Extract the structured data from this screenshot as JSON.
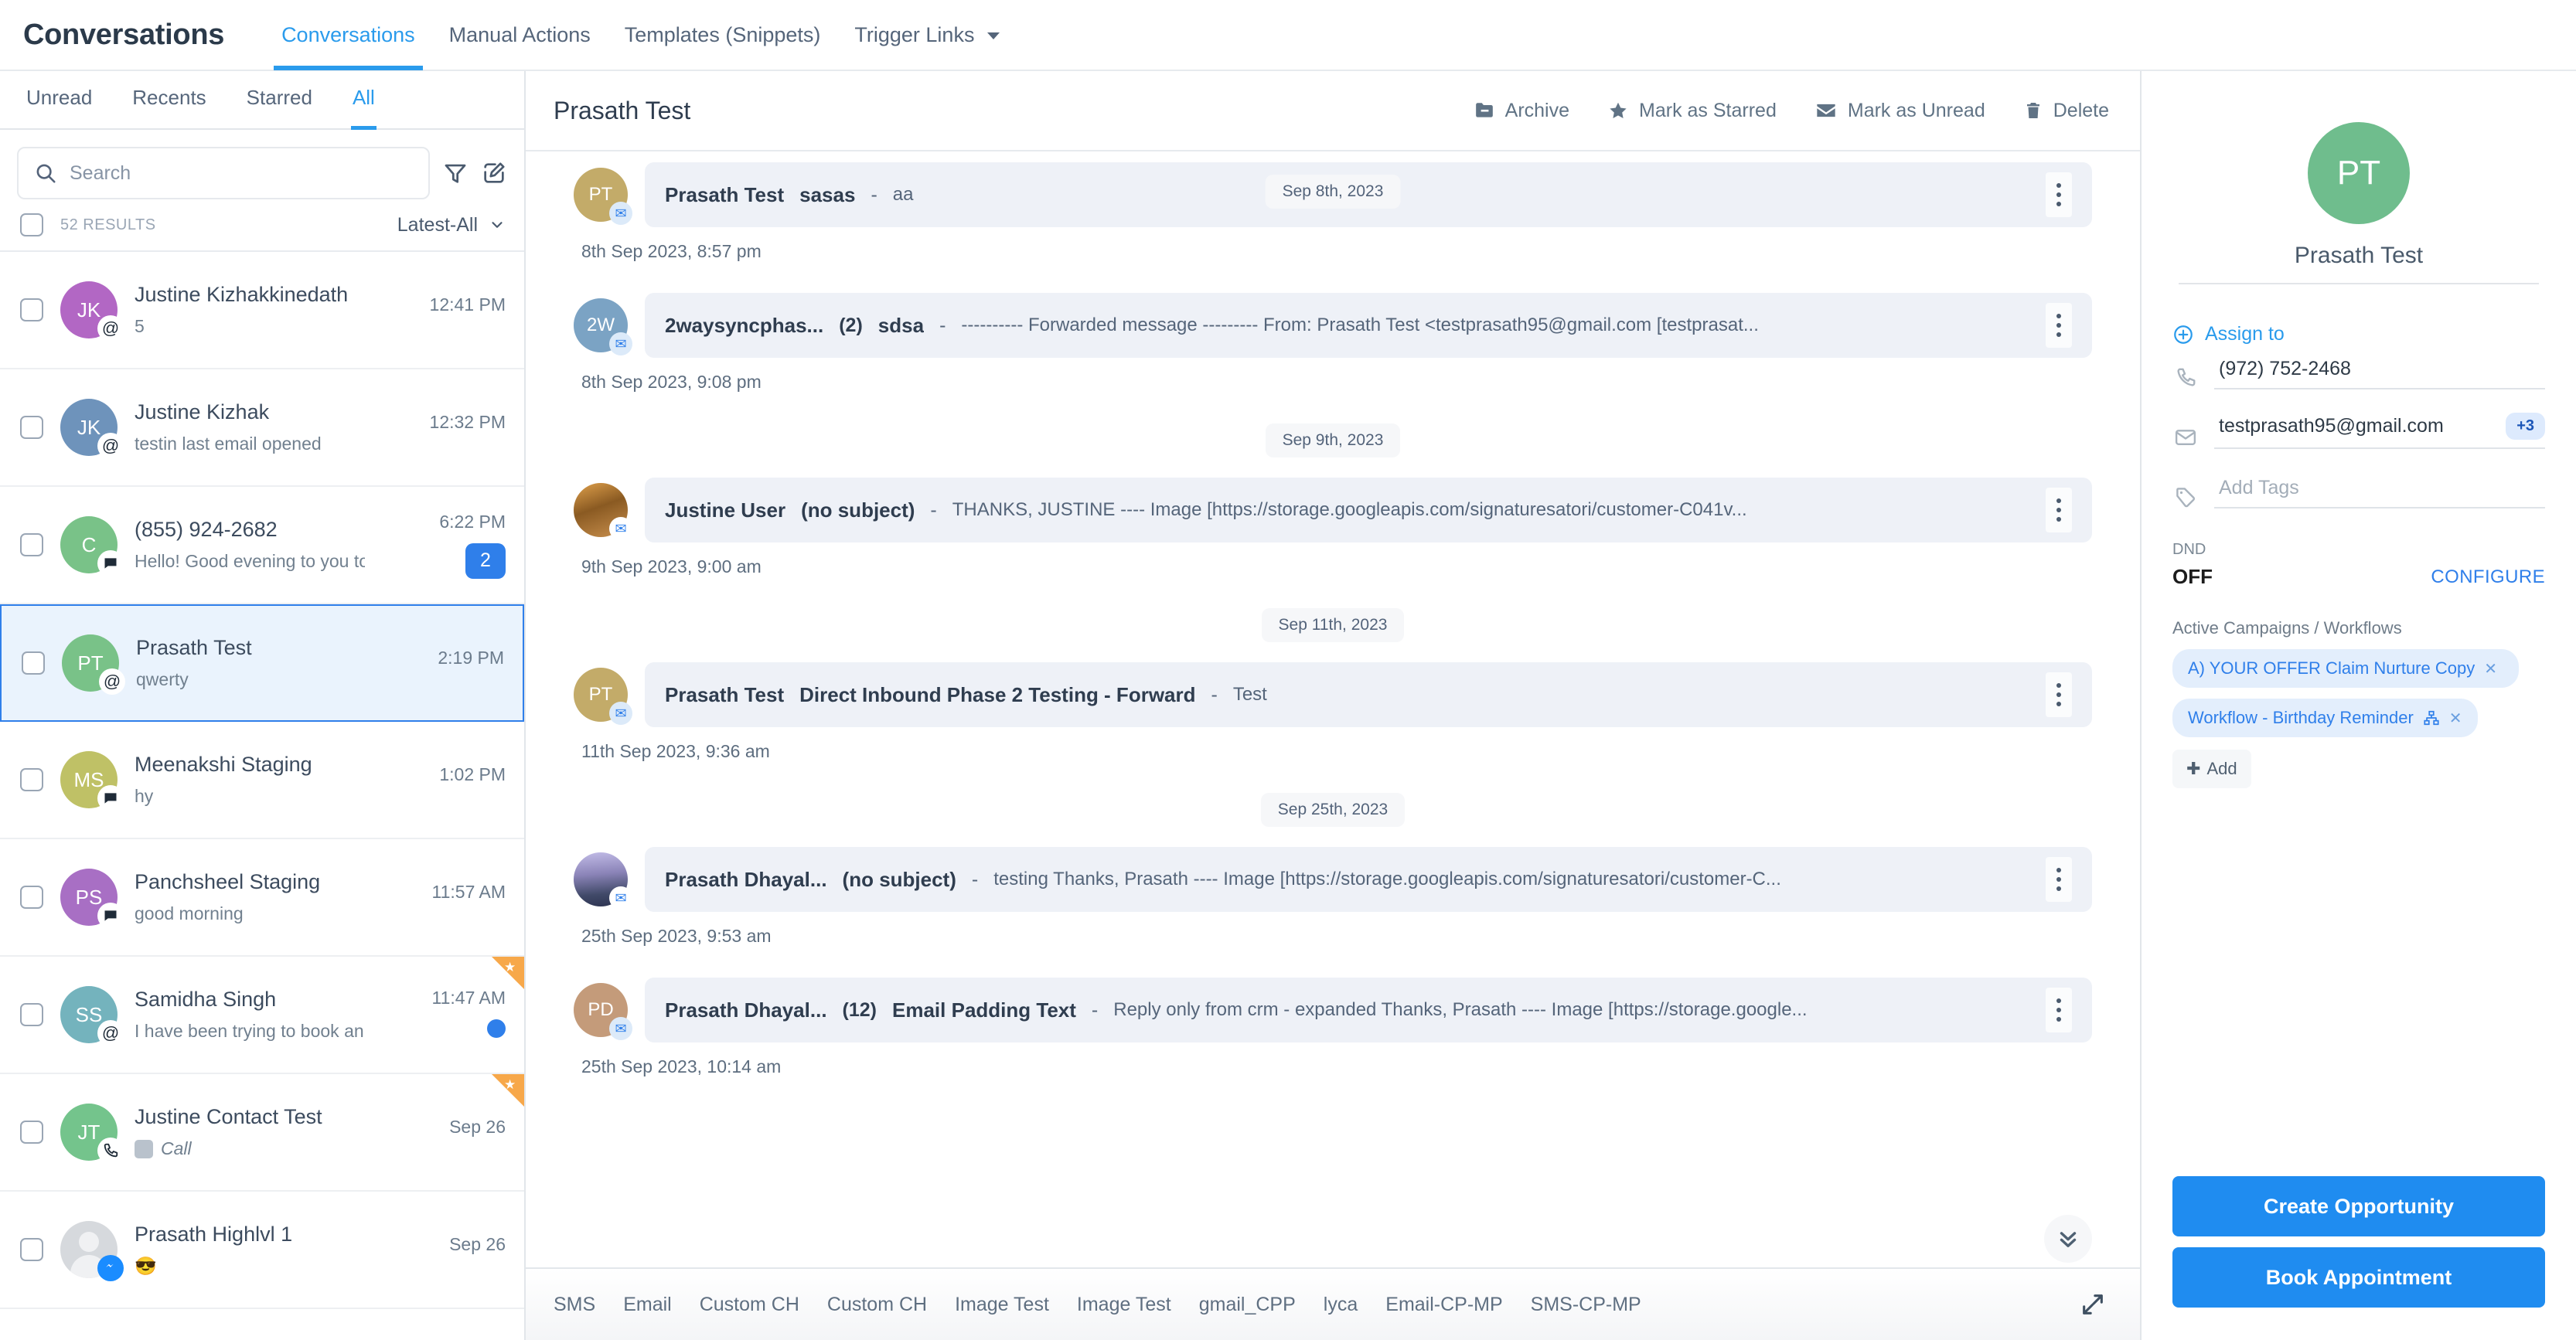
{
  "header": {
    "app_title": "Conversations",
    "nav": [
      {
        "label": "Conversations",
        "active": true
      },
      {
        "label": "Manual Actions",
        "active": false
      },
      {
        "label": "Templates (Snippets)",
        "active": false
      },
      {
        "label": "Trigger Links",
        "active": false,
        "caret": true
      }
    ]
  },
  "left": {
    "filter_tabs": [
      {
        "label": "Unread"
      },
      {
        "label": "Recents"
      },
      {
        "label": "Starred"
      },
      {
        "label": "All"
      }
    ],
    "search": {
      "placeholder": "Search",
      "value": ""
    },
    "results_count": "52 RESULTS",
    "sort_label": "Latest-All",
    "conversations": [
      {
        "initials": "JK",
        "color": "#b islands",
        "avatar_color": "#b267c4",
        "name": "Justine Kizhakkinedath",
        "preview": "5",
        "time": "12:41 PM",
        "channel": "@",
        "badge": "",
        "starred": false,
        "selected": false
      },
      {
        "initials": "JK",
        "avatar_color": "#6e93bb",
        "name": "Justine Kizhak",
        "preview": "testin last email opened",
        "time": "12:32 PM",
        "channel": "@",
        "badge": "",
        "starred": false,
        "selected": false
      },
      {
        "initials": "C",
        "avatar_color": "#79c288",
        "name": "(855) 924-2682",
        "preview": "Hello! Good evening to you too! How",
        "time": "6:22 PM",
        "channel": "sms",
        "badge": "2",
        "starred": false,
        "selected": false
      },
      {
        "initials": "PT",
        "avatar_color": "#79c288",
        "name": "Prasath Test",
        "preview": "qwerty",
        "time": "2:19 PM",
        "channel": "@",
        "badge": "",
        "starred": false,
        "selected": true
      },
      {
        "initials": "MS",
        "avatar_color": "#bfc166",
        "name": "Meenakshi Staging",
        "preview": "hy",
        "time": "1:02 PM",
        "channel": "sms",
        "badge": "",
        "starred": false,
        "selected": false
      },
      {
        "initials": "PS",
        "avatar_color": "#a86fc4",
        "name": "Panchsheel Staging",
        "preview": "good morning",
        "time": "11:57 AM",
        "channel": "sms",
        "badge": "",
        "starred": false,
        "selected": false
      },
      {
        "initials": "SS",
        "avatar_color": "#74b3bd",
        "name": "Samidha Singh",
        "preview": "I have been trying to book an appoint",
        "time": "11:47 AM",
        "channel": "@",
        "badge": "dot",
        "starred": true,
        "selected": false
      },
      {
        "initials": "JT",
        "avatar_color": "#74c48c",
        "name": "Justine Contact Test",
        "preview": "Call",
        "time": "Sep 26",
        "channel": "call",
        "badge": "",
        "starred": true,
        "selected": false,
        "call_tag": true
      },
      {
        "initials": "",
        "avatar_color": "generic",
        "name": "Prasath Highlvl 1",
        "preview": "😎",
        "time": "Sep 26",
        "channel": "fb",
        "badge": "",
        "starred": false,
        "selected": false
      }
    ]
  },
  "thread": {
    "title": "Prasath Test",
    "actions": [
      {
        "label": "Archive",
        "icon": "archive-icon"
      },
      {
        "label": "Mark as Starred",
        "icon": "star-icon"
      },
      {
        "label": "Mark as Unread",
        "icon": "envelope-icon"
      },
      {
        "label": "Delete",
        "icon": "trash-icon"
      }
    ],
    "items": [
      {
        "kind": "message",
        "initials": "PT",
        "avatar_color": "#c3ab69",
        "avatar_type": "initials",
        "sender": "Prasath Test",
        "count": "",
        "subject": "sasas",
        "snippet": "aa",
        "time": "8th Sep 2023, 8:57 pm"
      },
      {
        "kind": "date",
        "label": "Sep 8th, 2023"
      },
      {
        "kind": "message",
        "initials": "2W",
        "avatar_color": "#7ba3c4",
        "avatar_type": "initials",
        "sender": "2waysyncphas...",
        "count": "(2)",
        "subject": "sdsa",
        "snippet": "---------- Forwarded message --------- From: Prasath Test <testprasath95@gmail.com [testprasat...",
        "time": "8th Sep 2023, 9:08 pm"
      },
      {
        "kind": "date",
        "label": "Sep 9th, 2023"
      },
      {
        "kind": "message",
        "initials": "",
        "avatar_color": "",
        "avatar_type": "photo",
        "sender": "Justine User",
        "count": "",
        "subject": "(no subject)",
        "snippet": "THANKS, JUSTINE ---- Image [https://storage.googleapis.com/signaturesatori/customer-C041v...",
        "time": "9th Sep 2023, 9:00 am"
      },
      {
        "kind": "date",
        "label": "Sep 11th, 2023"
      },
      {
        "kind": "message",
        "initials": "PT",
        "avatar_color": "#c3ab69",
        "avatar_type": "initials",
        "sender": "Prasath Test",
        "count": "",
        "subject": "Direct Inbound Phase 2 Testing - Forward",
        "snippet": "Test",
        "time": "11th Sep 2023, 9:36 am"
      },
      {
        "kind": "date",
        "label": "Sep 25th, 2023"
      },
      {
        "kind": "message",
        "initials": "",
        "avatar_color": "",
        "avatar_type": "photo2",
        "sender": "Prasath Dhayal...",
        "count": "",
        "subject": "(no subject)",
        "snippet": "testing Thanks, Prasath ---- Image [https://storage.googleapis.com/signaturesatori/customer-C...",
        "time": "25th Sep 2023, 9:53 am"
      },
      {
        "kind": "message",
        "initials": "PD",
        "avatar_color": "#c49b7a",
        "avatar_type": "initials",
        "sender": "Prasath Dhayal...",
        "count": "(12)",
        "subject": "Email Padding Text",
        "snippet": "Reply only from crm - expanded Thanks, Prasath ---- Image [https://storage.google...",
        "time": "25th Sep 2023, 10:14 am"
      }
    ],
    "composer_tabs": [
      "SMS",
      "Email",
      "Custom CH",
      "Custom CH",
      "Image Test",
      "Image Test",
      "gmail_CPP",
      "lyca",
      "Email-CP-MP",
      "SMS-CP-MP"
    ]
  },
  "contact": {
    "initials": "PT",
    "name": "Prasath Test",
    "assign_label": "Assign to",
    "phone": "(972) 752-2468",
    "email": "testprasath95@gmail.com",
    "email_extra": "+3",
    "tags_placeholder": "Add Tags",
    "dnd_label": "DND",
    "dnd_value": "OFF",
    "configure_label": "CONFIGURE",
    "campaigns_label": "Active Campaigns / Workflows",
    "campaigns": [
      {
        "label": "A) YOUR OFFER Claim Nurture Copy",
        "has_flow_icon": false
      },
      {
        "label": "Workflow - Birthday Reminder",
        "has_flow_icon": true
      }
    ],
    "add_label": "Add",
    "buttons": [
      {
        "label": "Create Opportunity"
      },
      {
        "label": "Book Appointment"
      }
    ]
  },
  "colors": {
    "accent": "#2a9bec",
    "primary_button": "#1f8cf0",
    "selected_row": "#eaf3fd",
    "bubble": "#eef1f7",
    "star": "#f7a84a"
  }
}
